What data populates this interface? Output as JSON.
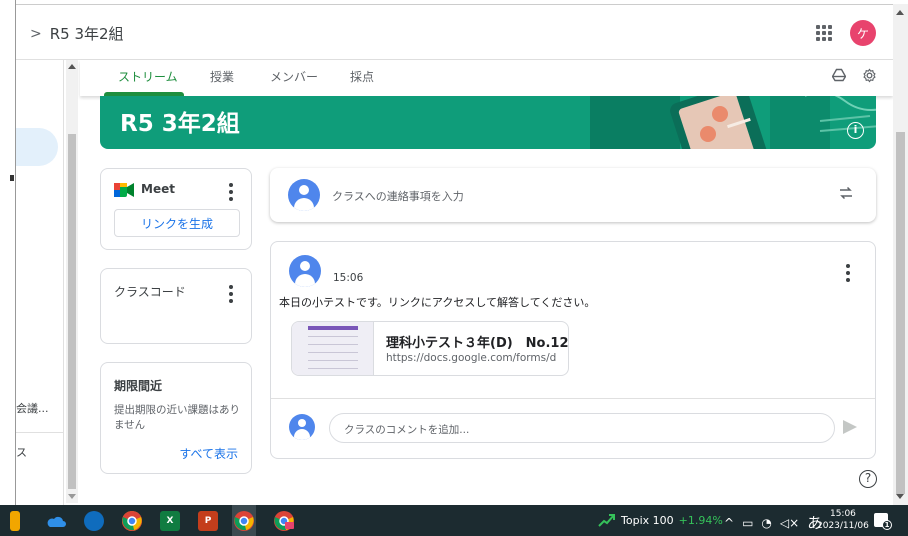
{
  "header": {
    "breadcrumb_chevron": ">",
    "class_name": "R5 3年2組",
    "avatar_letter": "ケ"
  },
  "drawer": {
    "truncated_item_1": "会議...",
    "truncated_item_2": "ス"
  },
  "tabs": [
    {
      "label": "ストリーム",
      "active": true
    },
    {
      "label": "授業",
      "active": false
    },
    {
      "label": "メンバー",
      "active": false
    },
    {
      "label": "採点",
      "active": false
    }
  ],
  "banner": {
    "title": "R5 3年2組",
    "info_glyph": "i"
  },
  "meet": {
    "label": "Meet",
    "button": "リンクを生成"
  },
  "class_code": {
    "label": "クラスコード"
  },
  "due": {
    "title": "期限間近",
    "text": "提出期限の近い課題はありません",
    "link": "すべて表示"
  },
  "announce": {
    "placeholder": "クラスへの連絡事項を入力"
  },
  "post": {
    "time": "15:06",
    "body": "本日の小テストです。リンクにアクセスして解答してください。",
    "attachment_title": "理科小テスト３年(D)　No.12",
    "attachment_url": "https://docs.google.com/forms/d",
    "comment_placeholder": "クラスのコメントを追加..."
  },
  "help_glyph": "?",
  "taskbar": {
    "ticker_name": "Topix 100",
    "ticker_change": "+1.94%",
    "ime": "あ",
    "time": "15:06",
    "date": "2023/11/06",
    "notification_count": "1"
  },
  "colors": {
    "brand_green": "#1e8e3e",
    "banner_teal": "#0f9d7a",
    "link_blue": "#1a73e8",
    "avatar_pink": "#e8436d"
  }
}
